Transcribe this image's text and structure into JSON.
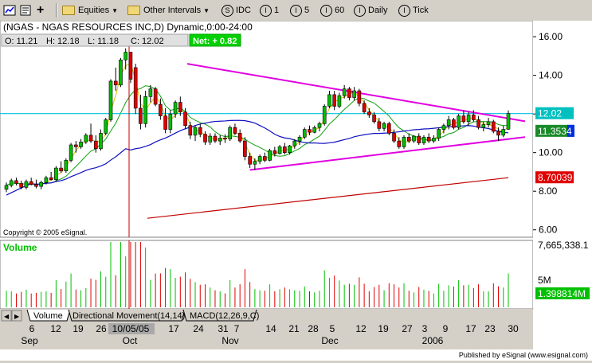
{
  "toolbar": {
    "items": [
      "Equities",
      "Other Intervals",
      "IDC",
      "1",
      "5",
      "60",
      "Daily",
      "Tick"
    ],
    "circle_letters": [
      "S",
      "I",
      "I",
      "I",
      "I"
    ]
  },
  "header": {
    "title": "(NGAS - NGAS RESOURCES INC,D) Dynamic,0:00-24:00",
    "open": "O: 11.21",
    "high": "H: 12.18",
    "low": "L: 11.18",
    "close": "C: 12.02",
    "net": "Net: + 0.82"
  },
  "copyright": "Copyright © 2005 eSignal.",
  "published": "Published by eSignal (www.esignal.com)",
  "volume_label": "Volume",
  "tabs": [
    "Volume",
    "Directional Movement(14,14)",
    "MACD(12,26,9,C)"
  ],
  "price_axis": {
    "ticks": [
      "16.00",
      "14.00",
      "12.00",
      "10.00",
      "8.00",
      "6.00"
    ],
    "badges": [
      {
        "text": "12.02",
        "bg": "#00c0c0"
      },
      {
        "text": "11.3534",
        "bg": "#1a8a2a"
      },
      {
        "text": "8.70039",
        "bg": "#e00000"
      }
    ]
  },
  "volume_axis": {
    "ticks": [
      "7,665,338.1",
      "5M",
      "1.398814M"
    ]
  },
  "date_axis": {
    "days": [
      "6",
      "12",
      "19",
      "26",
      "10/05/05",
      "17",
      "24",
      "31",
      "7",
      "14",
      "21",
      "28",
      "5",
      "12",
      "19",
      "27",
      "3",
      "9",
      "17",
      "23",
      "30"
    ],
    "months": [
      "Sep",
      "Oct",
      "Nov",
      "Dec",
      "2006"
    ]
  },
  "colors": {
    "up": "#00c000",
    "down": "#e00000",
    "trend": "#e000e0",
    "ma_blue": "#1010c0",
    "ma_green": "#10a010",
    "ma_yellow": "#e0c000",
    "ma_red": "#c00000",
    "cyan": "#00c0e0"
  },
  "chart_data": {
    "type": "candlestick",
    "symbol": "NGAS",
    "interval": "Daily",
    "ylim": [
      6,
      16
    ],
    "ohlc": [
      {
        "date": "2005-08-29",
        "o": 8.1,
        "h": 8.45,
        "l": 7.95,
        "c": 8.3
      },
      {
        "date": "2005-08-30",
        "o": 8.3,
        "h": 8.65,
        "l": 8.2,
        "c": 8.55
      },
      {
        "date": "2005-08-31",
        "o": 8.55,
        "h": 8.7,
        "l": 8.3,
        "c": 8.4
      },
      {
        "date": "2005-09-01",
        "o": 8.4,
        "h": 8.55,
        "l": 8.1,
        "c": 8.2
      },
      {
        "date": "2005-09-02",
        "o": 8.2,
        "h": 8.6,
        "l": 8.1,
        "c": 8.5
      },
      {
        "date": "2005-09-06",
        "o": 8.5,
        "h": 8.7,
        "l": 8.3,
        "c": 8.35
      },
      {
        "date": "2005-09-07",
        "o": 8.35,
        "h": 8.6,
        "l": 8.15,
        "c": 8.25
      },
      {
        "date": "2005-09-08",
        "o": 8.25,
        "h": 8.55,
        "l": 8.1,
        "c": 8.45
      },
      {
        "date": "2005-09-09",
        "o": 8.45,
        "h": 8.8,
        "l": 8.35,
        "c": 8.7
      },
      {
        "date": "2005-09-12",
        "o": 8.7,
        "h": 9.0,
        "l": 8.55,
        "c": 8.6
      },
      {
        "date": "2005-09-13",
        "o": 8.6,
        "h": 9.3,
        "l": 8.5,
        "c": 9.2
      },
      {
        "date": "2005-09-14",
        "o": 9.2,
        "h": 9.55,
        "l": 8.95,
        "c": 9.05
      },
      {
        "date": "2005-09-15",
        "o": 9.05,
        "h": 9.7,
        "l": 8.95,
        "c": 9.6
      },
      {
        "date": "2005-09-16",
        "o": 9.6,
        "h": 10.5,
        "l": 9.5,
        "c": 10.4
      },
      {
        "date": "2005-09-19",
        "o": 10.4,
        "h": 10.6,
        "l": 10.0,
        "c": 10.3
      },
      {
        "date": "2005-09-20",
        "o": 10.3,
        "h": 10.7,
        "l": 10.2,
        "c": 10.55
      },
      {
        "date": "2005-09-21",
        "o": 10.55,
        "h": 11.0,
        "l": 10.45,
        "c": 10.9
      },
      {
        "date": "2005-09-22",
        "o": 10.9,
        "h": 11.5,
        "l": 10.5,
        "c": 10.6
      },
      {
        "date": "2005-09-23",
        "o": 10.6,
        "h": 10.9,
        "l": 10.0,
        "c": 10.2
      },
      {
        "date": "2005-09-26",
        "o": 10.2,
        "h": 11.2,
        "l": 10.1,
        "c": 11.0
      },
      {
        "date": "2005-09-27",
        "o": 11.0,
        "h": 11.8,
        "l": 10.9,
        "c": 11.7
      },
      {
        "date": "2005-09-28",
        "o": 11.7,
        "h": 13.8,
        "l": 11.6,
        "c": 13.7
      },
      {
        "date": "2005-09-29",
        "o": 13.7,
        "h": 14.4,
        "l": 13.2,
        "c": 13.5
      },
      {
        "date": "2005-09-30",
        "o": 13.5,
        "h": 14.9,
        "l": 13.4,
        "c": 14.8
      },
      {
        "date": "2005-10-03",
        "o": 14.8,
        "h": 15.4,
        "l": 14.3,
        "c": 15.2
      },
      {
        "date": "2005-10-04",
        "o": 15.2,
        "h": 15.2,
        "l": 13.6,
        "c": 13.8
      },
      {
        "date": "2005-10-05",
        "o": 14.4,
        "h": 14.6,
        "l": 12.0,
        "c": 12.3
      },
      {
        "date": "2005-10-06",
        "o": 12.3,
        "h": 13.0,
        "l": 11.2,
        "c": 11.5
      },
      {
        "date": "2005-10-07",
        "o": 11.5,
        "h": 13.2,
        "l": 11.3,
        "c": 12.9
      },
      {
        "date": "2005-10-10",
        "o": 12.9,
        "h": 13.5,
        "l": 12.6,
        "c": 13.3
      },
      {
        "date": "2005-10-11",
        "o": 13.3,
        "h": 13.4,
        "l": 12.4,
        "c": 12.5
      },
      {
        "date": "2005-10-12",
        "o": 12.5,
        "h": 12.8,
        "l": 11.7,
        "c": 11.9
      },
      {
        "date": "2005-10-13",
        "o": 11.9,
        "h": 12.3,
        "l": 11.0,
        "c": 11.2
      },
      {
        "date": "2005-10-14",
        "o": 11.2,
        "h": 12.2,
        "l": 11.0,
        "c": 12.0
      },
      {
        "date": "2005-10-17",
        "o": 12.0,
        "h": 12.7,
        "l": 11.8,
        "c": 12.6
      },
      {
        "date": "2005-10-18",
        "o": 12.6,
        "h": 12.9,
        "l": 11.9,
        "c": 12.1
      },
      {
        "date": "2005-10-19",
        "o": 12.1,
        "h": 12.3,
        "l": 11.2,
        "c": 11.4
      },
      {
        "date": "2005-10-20",
        "o": 11.4,
        "h": 11.6,
        "l": 10.7,
        "c": 10.9
      },
      {
        "date": "2005-10-21",
        "o": 10.9,
        "h": 11.4,
        "l": 10.6,
        "c": 11.3
      },
      {
        "date": "2005-10-24",
        "o": 11.3,
        "h": 11.5,
        "l": 10.8,
        "c": 10.95
      },
      {
        "date": "2005-10-25",
        "o": 10.95,
        "h": 11.1,
        "l": 10.4,
        "c": 10.55
      },
      {
        "date": "2005-10-26",
        "o": 10.55,
        "h": 11.0,
        "l": 10.4,
        "c": 10.85
      },
      {
        "date": "2005-10-27",
        "o": 10.85,
        "h": 11.0,
        "l": 10.5,
        "c": 10.6
      },
      {
        "date": "2005-10-28",
        "o": 10.6,
        "h": 10.9,
        "l": 10.4,
        "c": 10.75
      },
      {
        "date": "2005-10-31",
        "o": 10.75,
        "h": 10.95,
        "l": 10.5,
        "c": 10.7
      },
      {
        "date": "2005-11-01",
        "o": 10.7,
        "h": 11.4,
        "l": 10.6,
        "c": 11.3
      },
      {
        "date": "2005-11-02",
        "o": 11.3,
        "h": 11.5,
        "l": 10.9,
        "c": 11.0
      },
      {
        "date": "2005-11-03",
        "o": 11.0,
        "h": 11.2,
        "l": 10.5,
        "c": 10.6
      },
      {
        "date": "2005-11-04",
        "o": 10.6,
        "h": 10.8,
        "l": 9.6,
        "c": 9.8
      },
      {
        "date": "2005-11-07",
        "o": 9.8,
        "h": 10.0,
        "l": 9.2,
        "c": 9.4
      },
      {
        "date": "2005-11-08",
        "o": 9.4,
        "h": 9.7,
        "l": 9.1,
        "c": 9.55
      },
      {
        "date": "2005-11-09",
        "o": 9.55,
        "h": 9.9,
        "l": 9.4,
        "c": 9.8
      },
      {
        "date": "2005-11-10",
        "o": 9.8,
        "h": 10.0,
        "l": 9.5,
        "c": 9.6
      },
      {
        "date": "2005-11-11",
        "o": 9.6,
        "h": 10.2,
        "l": 9.55,
        "c": 10.1
      },
      {
        "date": "2005-11-14",
        "o": 10.1,
        "h": 10.3,
        "l": 9.8,
        "c": 9.95
      },
      {
        "date": "2005-11-15",
        "o": 9.95,
        "h": 10.4,
        "l": 9.9,
        "c": 10.3
      },
      {
        "date": "2005-11-16",
        "o": 10.3,
        "h": 10.5,
        "l": 9.9,
        "c": 10.0
      },
      {
        "date": "2005-11-17",
        "o": 10.0,
        "h": 10.4,
        "l": 9.9,
        "c": 10.35
      },
      {
        "date": "2005-11-18",
        "o": 10.35,
        "h": 10.7,
        "l": 10.2,
        "c": 10.6
      },
      {
        "date": "2005-11-21",
        "o": 10.6,
        "h": 10.9,
        "l": 10.4,
        "c": 10.8
      },
      {
        "date": "2005-11-22",
        "o": 10.8,
        "h": 11.3,
        "l": 10.7,
        "c": 11.2
      },
      {
        "date": "2005-11-23",
        "o": 11.2,
        "h": 11.4,
        "l": 10.9,
        "c": 11.05
      },
      {
        "date": "2005-11-25",
        "o": 11.05,
        "h": 11.4,
        "l": 11.0,
        "c": 11.3
      },
      {
        "date": "2005-11-28",
        "o": 11.3,
        "h": 11.6,
        "l": 11.1,
        "c": 11.5
      },
      {
        "date": "2005-11-29",
        "o": 11.5,
        "h": 12.5,
        "l": 11.4,
        "c": 12.4
      },
      {
        "date": "2005-11-30",
        "o": 12.4,
        "h": 13.2,
        "l": 12.3,
        "c": 13.0
      },
      {
        "date": "2005-12-01",
        "o": 13.0,
        "h": 13.2,
        "l": 12.2,
        "c": 12.4
      },
      {
        "date": "2005-12-02",
        "o": 12.4,
        "h": 13.1,
        "l": 12.3,
        "c": 12.95
      },
      {
        "date": "2005-12-05",
        "o": 12.95,
        "h": 13.5,
        "l": 12.8,
        "c": 13.3
      },
      {
        "date": "2005-12-06",
        "o": 13.3,
        "h": 13.4,
        "l": 12.7,
        "c": 12.85
      },
      {
        "date": "2005-12-07",
        "o": 12.85,
        "h": 13.4,
        "l": 12.7,
        "c": 13.2
      },
      {
        "date": "2005-12-08",
        "o": 13.2,
        "h": 13.3,
        "l": 12.4,
        "c": 12.55
      },
      {
        "date": "2005-12-09",
        "o": 12.55,
        "h": 12.7,
        "l": 12.0,
        "c": 12.1
      },
      {
        "date": "2005-12-12",
        "o": 12.1,
        "h": 12.3,
        "l": 11.8,
        "c": 11.95
      },
      {
        "date": "2005-12-13",
        "o": 11.95,
        "h": 12.1,
        "l": 11.5,
        "c": 11.6
      },
      {
        "date": "2005-12-14",
        "o": 11.6,
        "h": 11.8,
        "l": 11.1,
        "c": 11.25
      },
      {
        "date": "2005-12-15",
        "o": 11.25,
        "h": 11.6,
        "l": 11.1,
        "c": 11.5
      },
      {
        "date": "2005-12-16",
        "o": 11.5,
        "h": 11.6,
        "l": 10.9,
        "c": 11.0
      },
      {
        "date": "2005-12-19",
        "o": 11.0,
        "h": 11.2,
        "l": 10.5,
        "c": 10.6
      },
      {
        "date": "2005-12-20",
        "o": 10.6,
        "h": 10.8,
        "l": 10.2,
        "c": 10.3
      },
      {
        "date": "2005-12-21",
        "o": 10.3,
        "h": 10.9,
        "l": 10.2,
        "c": 10.8
      },
      {
        "date": "2005-12-22",
        "o": 10.8,
        "h": 11.0,
        "l": 10.5,
        "c": 10.6
      },
      {
        "date": "2005-12-23",
        "o": 10.6,
        "h": 10.9,
        "l": 10.5,
        "c": 10.85
      },
      {
        "date": "2005-12-27",
        "o": 10.85,
        "h": 11.0,
        "l": 10.4,
        "c": 10.5
      },
      {
        "date": "2005-12-28",
        "o": 10.5,
        "h": 10.9,
        "l": 10.4,
        "c": 10.8
      },
      {
        "date": "2005-12-29",
        "o": 10.8,
        "h": 11.0,
        "l": 10.5,
        "c": 10.6
      },
      {
        "date": "2005-12-30",
        "o": 10.6,
        "h": 10.9,
        "l": 10.5,
        "c": 10.75
      },
      {
        "date": "2006-01-03",
        "o": 10.75,
        "h": 11.3,
        "l": 10.6,
        "c": 11.2
      },
      {
        "date": "2006-01-04",
        "o": 11.2,
        "h": 11.5,
        "l": 11.0,
        "c": 11.4
      },
      {
        "date": "2006-01-05",
        "o": 11.4,
        "h": 11.9,
        "l": 11.2,
        "c": 11.7
      },
      {
        "date": "2006-01-06",
        "o": 11.7,
        "h": 11.8,
        "l": 11.2,
        "c": 11.3
      },
      {
        "date": "2006-01-09",
        "o": 11.3,
        "h": 12.0,
        "l": 11.2,
        "c": 11.9
      },
      {
        "date": "2006-01-10",
        "o": 11.9,
        "h": 12.2,
        "l": 11.5,
        "c": 11.6
      },
      {
        "date": "2006-01-11",
        "o": 11.6,
        "h": 12.1,
        "l": 11.4,
        "c": 11.95
      },
      {
        "date": "2006-01-12",
        "o": 11.95,
        "h": 12.2,
        "l": 11.6,
        "c": 11.7
      },
      {
        "date": "2006-01-13",
        "o": 11.7,
        "h": 11.9,
        "l": 11.2,
        "c": 11.3
      },
      {
        "date": "2006-01-17",
        "o": 11.3,
        "h": 11.6,
        "l": 11.1,
        "c": 11.45
      },
      {
        "date": "2006-01-18",
        "o": 11.45,
        "h": 11.8,
        "l": 11.3,
        "c": 11.6
      },
      {
        "date": "2006-01-19",
        "o": 11.6,
        "h": 11.7,
        "l": 11.0,
        "c": 11.1
      },
      {
        "date": "2006-01-20",
        "o": 11.1,
        "h": 11.3,
        "l": 10.6,
        "c": 10.9
      },
      {
        "date": "2006-01-23",
        "o": 10.9,
        "h": 11.4,
        "l": 10.8,
        "c": 11.2
      },
      {
        "date": "2006-01-24",
        "o": 11.21,
        "h": 12.18,
        "l": 11.18,
        "c": 12.02
      }
    ],
    "moving_averages": [
      {
        "color": "blue",
        "values": [
          7.8,
          11.4
        ],
        "note": "long"
      },
      {
        "color": "red",
        "values": [
          6.6,
          8.7
        ],
        "note": "longest"
      }
    ],
    "trendlines": [
      {
        "from": [
          "2005-10-05",
          14.6
        ],
        "to": [
          "2006-01-24",
          11.75
        ]
      },
      {
        "from": [
          "2005-11-07",
          9.1
        ],
        "to": [
          "2006-01-24",
          10.7
        ]
      }
    ],
    "horizontal_line": 12.02,
    "volume_ylim": [
      0,
      7665338
    ]
  }
}
